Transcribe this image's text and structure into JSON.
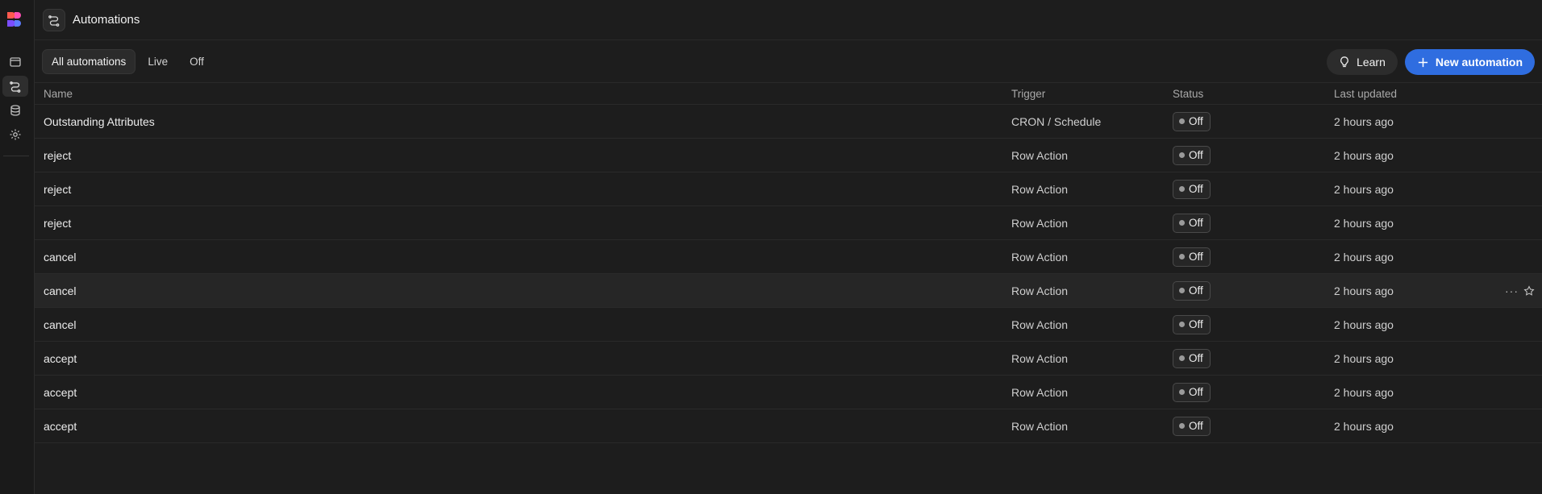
{
  "header": {
    "title": "Automations",
    "title_icon": "automation-icon"
  },
  "sidebar": {
    "logo": "budibase-logo",
    "items": [
      {
        "name": "apps",
        "icon": "window-icon",
        "active": false
      },
      {
        "name": "automations",
        "icon": "automation-icon",
        "active": true
      },
      {
        "name": "data",
        "icon": "database-icon",
        "active": false
      },
      {
        "name": "settings",
        "icon": "gear-icon",
        "active": false
      }
    ]
  },
  "tabs": [
    {
      "label": "All automations",
      "active": true
    },
    {
      "label": "Live",
      "active": false
    },
    {
      "label": "Off",
      "active": false
    }
  ],
  "actions": {
    "learn_label": "Learn",
    "new_label": "New automation"
  },
  "colors": {
    "accent": "#2f6de0",
    "background": "#1d1d1d"
  },
  "table": {
    "columns": {
      "name": "Name",
      "trigger": "Trigger",
      "status": "Status",
      "updated": "Last updated"
    },
    "rows": [
      {
        "name": "Outstanding Attributes",
        "trigger": "CRON / Schedule",
        "status": "Off",
        "updated": "2 hours ago"
      },
      {
        "name": "reject",
        "trigger": "Row Action",
        "status": "Off",
        "updated": "2 hours ago"
      },
      {
        "name": "reject",
        "trigger": "Row Action",
        "status": "Off",
        "updated": "2 hours ago"
      },
      {
        "name": "reject",
        "trigger": "Row Action",
        "status": "Off",
        "updated": "2 hours ago"
      },
      {
        "name": "cancel",
        "trigger": "Row Action",
        "status": "Off",
        "updated": "2 hours ago"
      },
      {
        "name": "cancel",
        "trigger": "Row Action",
        "status": "Off",
        "updated": "2 hours ago"
      },
      {
        "name": "cancel",
        "trigger": "Row Action",
        "status": "Off",
        "updated": "2 hours ago"
      },
      {
        "name": "accept",
        "trigger": "Row Action",
        "status": "Off",
        "updated": "2 hours ago"
      },
      {
        "name": "accept",
        "trigger": "Row Action",
        "status": "Off",
        "updated": "2 hours ago"
      },
      {
        "name": "accept",
        "trigger": "Row Action",
        "status": "Off",
        "updated": "2 hours ago"
      }
    ],
    "hovered_row": 5,
    "row_action_more": "···"
  }
}
